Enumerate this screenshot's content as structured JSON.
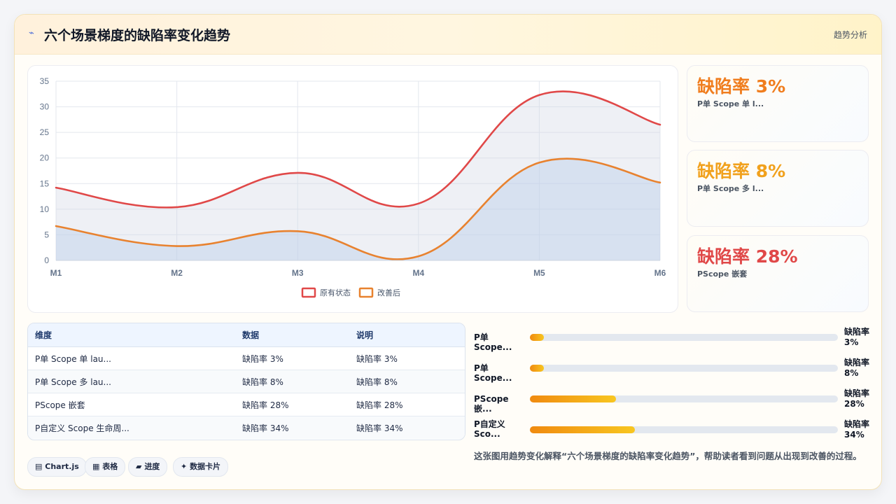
{
  "header": {
    "icon": "trend-icon",
    "title": "六个场景梯度的缺陷率变化趋势",
    "action": "趋势分析"
  },
  "chart_data": {
    "type": "line",
    "categories": [
      "M1",
      "M2",
      "M3",
      "M4",
      "M5",
      "M6"
    ],
    "series": [
      {
        "name": "原有状态",
        "values": [
          14.2,
          10.4,
          17.1,
          11.1,
          32.3,
          26.5
        ],
        "color": "#e04848"
      },
      {
        "name": "改善后",
        "values": [
          6.7,
          2.8,
          5.7,
          0.8,
          19.1,
          15.2
        ],
        "color": "#e8822f"
      }
    ],
    "ylim": [
      0,
      35
    ],
    "yticks": [
      0,
      5,
      10,
      15,
      20,
      25,
      30,
      35
    ],
    "grid": true,
    "legend": "bottom-center"
  },
  "stats": [
    {
      "value": "缺陷率 3%",
      "label": "P单 Scope 单 l...",
      "color": "#f07d1e"
    },
    {
      "value": "缺陷率 8%",
      "label": "P单 Scope 多 l...",
      "color": "#f1a11d"
    },
    {
      "value": "缺陷率 28%",
      "label": "PScope 嵌套",
      "color": "#e04848"
    }
  ],
  "table": {
    "headers": [
      "维度",
      "数据",
      "说明"
    ],
    "rows": [
      [
        "P单 Scope 单 lau...",
        "缺陷率 3%",
        "缺陷率 3%"
      ],
      [
        "P单 Scope 多 lau...",
        "缺陷率 8%",
        "缺陷率 8%"
      ],
      [
        "PScope 嵌套",
        "缺陷率 28%",
        "缺陷率 28%"
      ],
      [
        "P自定义 Scope 生命周...",
        "缺陷率 34%",
        "缺陷率 34%"
      ]
    ]
  },
  "progress": [
    {
      "label": "P单 Scope...",
      "value_label": "缺陷率 3%",
      "percent": 3
    },
    {
      "label": "P单 Scope...",
      "value_label": "缺陷率 8%",
      "percent": 3
    },
    {
      "label": "PScope 嵌...",
      "value_label": "缺陷率 28%",
      "percent": 28
    },
    {
      "label": "P自定义 Sco...",
      "value_label": "缺陷率 34%",
      "percent": 34
    }
  ],
  "tags": [
    {
      "icon": "chart-icon",
      "glyph": "▤",
      "label": "Chart.js"
    },
    {
      "icon": "table-icon",
      "glyph": "▦",
      "label": "表格"
    },
    {
      "icon": "progress-icon",
      "glyph": "▰",
      "label": "进度"
    },
    {
      "icon": "card-icon",
      "glyph": "✦",
      "label": "数据卡片"
    }
  ],
  "caption": "这张图用趋势变化解释“六个场景梯度的缺陷率变化趋势”，帮助读者看到问题从出现到改善的过程。"
}
